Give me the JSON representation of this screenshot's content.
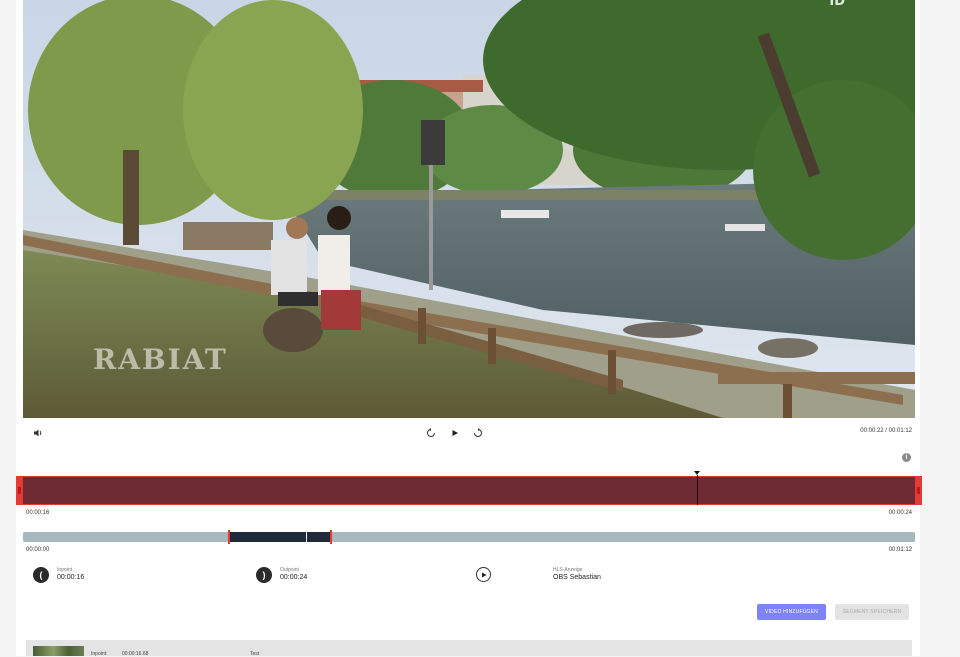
{
  "video": {
    "watermark": "RABIAT",
    "channel_badge": "ID"
  },
  "player": {
    "time_readout": "00:00:22 / 00:01:12",
    "icons": [
      "volume-icon",
      "rewind-10-icon",
      "play-icon",
      "forward-10-icon",
      "info-icon"
    ]
  },
  "segment": {
    "start_label": "00:00:16",
    "end_label": "00:00:24"
  },
  "overview": {
    "start_label": "00:00:00",
    "end_label": "00:01:12"
  },
  "points": {
    "inpoint_label": "Inpoint",
    "inpoint_value": "00:00:16",
    "inpoint_icon": "(",
    "outpoint_label": "Outpoint",
    "outpoint_value": "00:00:24",
    "outpoint_icon": ")",
    "hls_label": "HLS-Anzeige",
    "hls_value": "OBS Sebastian"
  },
  "actions": {
    "add_video": "VIDEO HINZUFÜGEN",
    "save_segment": "SEGMENT SPEICHERN"
  },
  "list": {
    "row_label": "Inpoint:",
    "row_time": "00:00:16.68",
    "row_title": "Test"
  },
  "colors": {
    "segment_fill": "#6e2a33",
    "segment_border": "#e53935",
    "overview_track": "#a8b8bf",
    "overview_range": "#1f2b3a",
    "primary_button": "#7e84f7"
  }
}
